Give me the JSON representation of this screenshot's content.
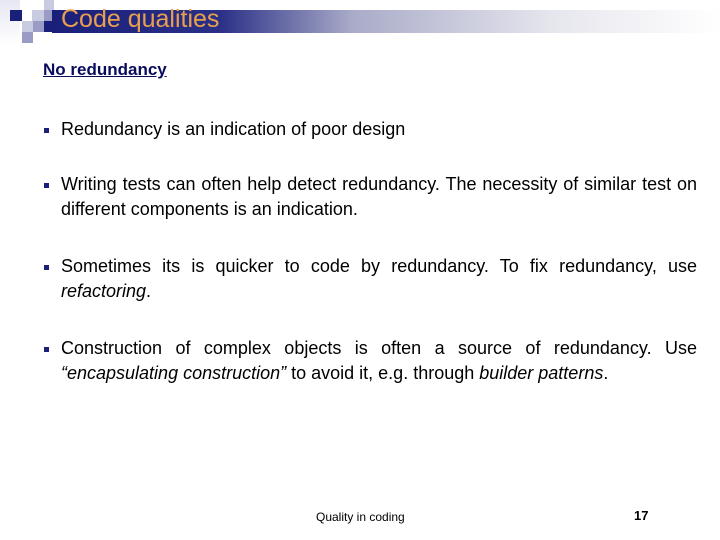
{
  "slide": {
    "title": "Code qualities",
    "subtitle": "No redundancy",
    "bullets": [
      {
        "parts": [
          {
            "text": "Redundancy is an indication of poor design",
            "italic": false
          }
        ]
      },
      {
        "parts": [
          {
            "text": "Writing tests can often help detect redundancy. The necessity of similar test on different components is an indication.",
            "italic": false
          }
        ]
      },
      {
        "parts": [
          {
            "text": "Sometimes its is quicker to code by redundancy. To fix redundancy, use ",
            "italic": false
          },
          {
            "text": "refactoring",
            "italic": true
          },
          {
            "text": ".",
            "italic": false
          }
        ]
      },
      {
        "parts": [
          {
            "text": "Construction of complex objects is often a source of redundancy. Use ",
            "italic": false
          },
          {
            "text": "“encapsulating construction”",
            "italic": true
          },
          {
            "text": " to avoid it, e.g. through ",
            "italic": false
          },
          {
            "text": "builder patterns",
            "italic": true
          },
          {
            "text": ".",
            "italic": false
          }
        ]
      }
    ],
    "footer": {
      "center_text": "Quality in coding",
      "page_number": "17"
    },
    "colors": {
      "title_text": "#e9a04e",
      "title_bar_start": "#1a1f7a",
      "subtitle_text": "#0b0b5e",
      "bullet": "#1a1f7a"
    }
  }
}
